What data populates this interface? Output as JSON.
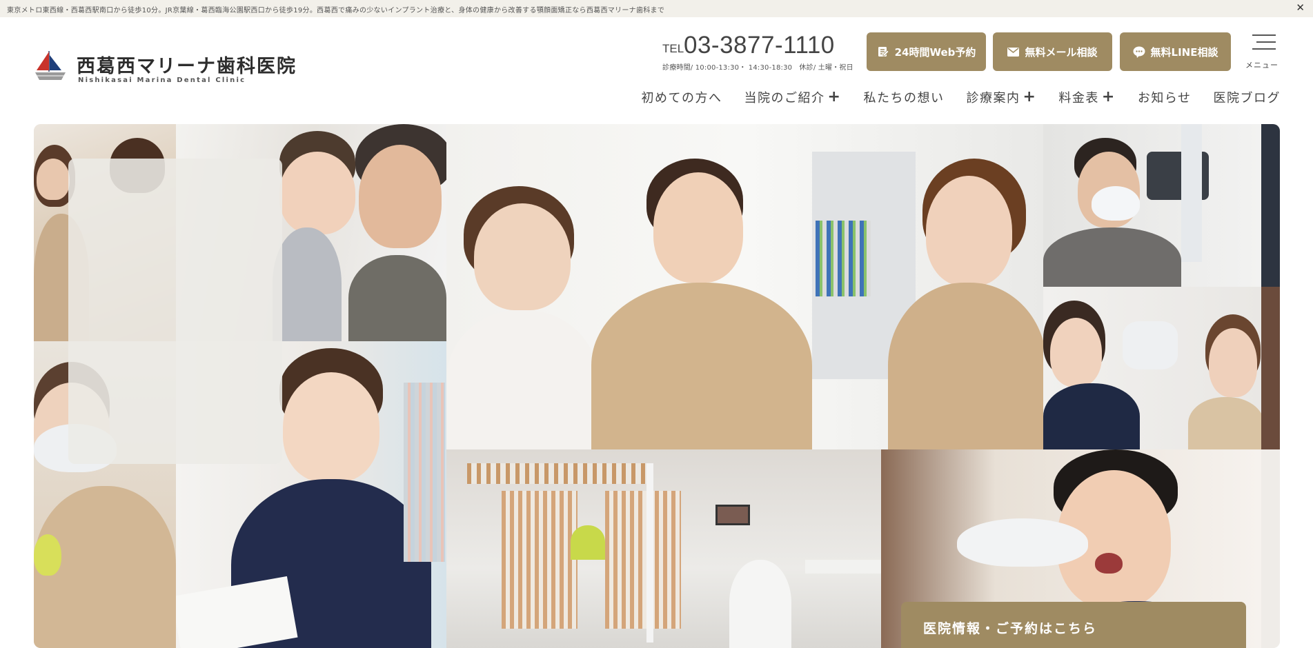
{
  "topbar": {
    "text": "東京メトロ東西線・西葛西駅南口から徒歩10分。JR京葉線・葛西臨海公園駅西口から徒歩19分。西葛西で痛みの少ないインプラント治療と、身体の健康から改善する顎顔面矯正なら西葛西マリーナ歯科まで",
    "close": "✕"
  },
  "logo": {
    "title": "西葛西マリーナ歯科医院",
    "subtitle": "Nishikasai Marina Dental Clinic",
    "icon": "sailboat-logo"
  },
  "contact": {
    "tel_prefix": "TEL",
    "tel_number": "03-3877-1110",
    "hours": "診療時間/ 10:00-13:30・ 14:30-18:30　休診/ 土曜・祝日"
  },
  "actions": [
    {
      "label": "24時間Web予約",
      "icon": "calendar-edit-icon"
    },
    {
      "label": "無料メール相談",
      "icon": "mail-icon"
    },
    {
      "label": "無料LINE相談",
      "icon": "line-chat-icon"
    }
  ],
  "menu": {
    "label": "メニュー",
    "icon": "hamburger-icon"
  },
  "nav": [
    {
      "label": "初めての方へ",
      "has_sub": false
    },
    {
      "label": "当院のご紹介",
      "has_sub": true
    },
    {
      "label": "私たちの想い",
      "has_sub": false
    },
    {
      "label": "診療案内",
      "has_sub": true
    },
    {
      "label": "料金表",
      "has_sub": true
    },
    {
      "label": "お知らせ",
      "has_sub": false
    },
    {
      "label": "医院ブログ",
      "has_sub": false
    }
  ],
  "nav_plus": "+",
  "hero": {
    "banner_label": "医院情報・ご予約はこちら"
  },
  "colors": {
    "accent": "#9f8b62",
    "topbar_bg": "#f2f0ea",
    "text": "#444444"
  }
}
